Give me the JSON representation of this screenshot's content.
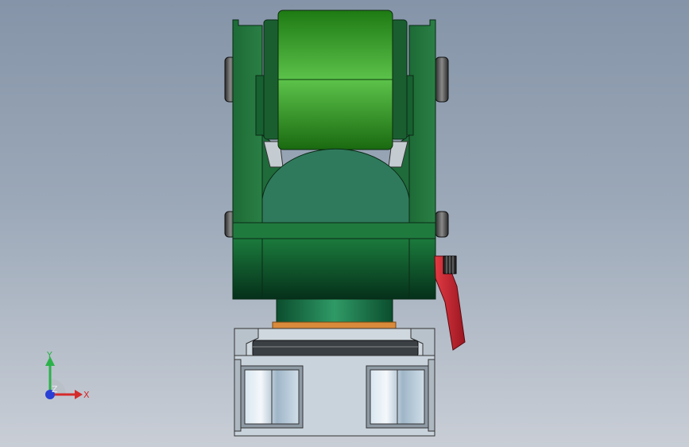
{
  "viewport": {
    "background_top": "#8594a8",
    "background_bottom": "#c9ced6"
  },
  "triad": {
    "x_label": "X",
    "y_label": "Y",
    "z_label": "Z",
    "x_color": "#d42a2a",
    "y_color": "#2bb24a",
    "z_color": "#2a3fd4"
  },
  "model": {
    "body_color": "#1f6b3a",
    "roller_color": "#2e8a2a",
    "clamp_handle_color": "#c8202c",
    "ring_color": "#d98a3a",
    "base_color": "#c9d3dc"
  }
}
